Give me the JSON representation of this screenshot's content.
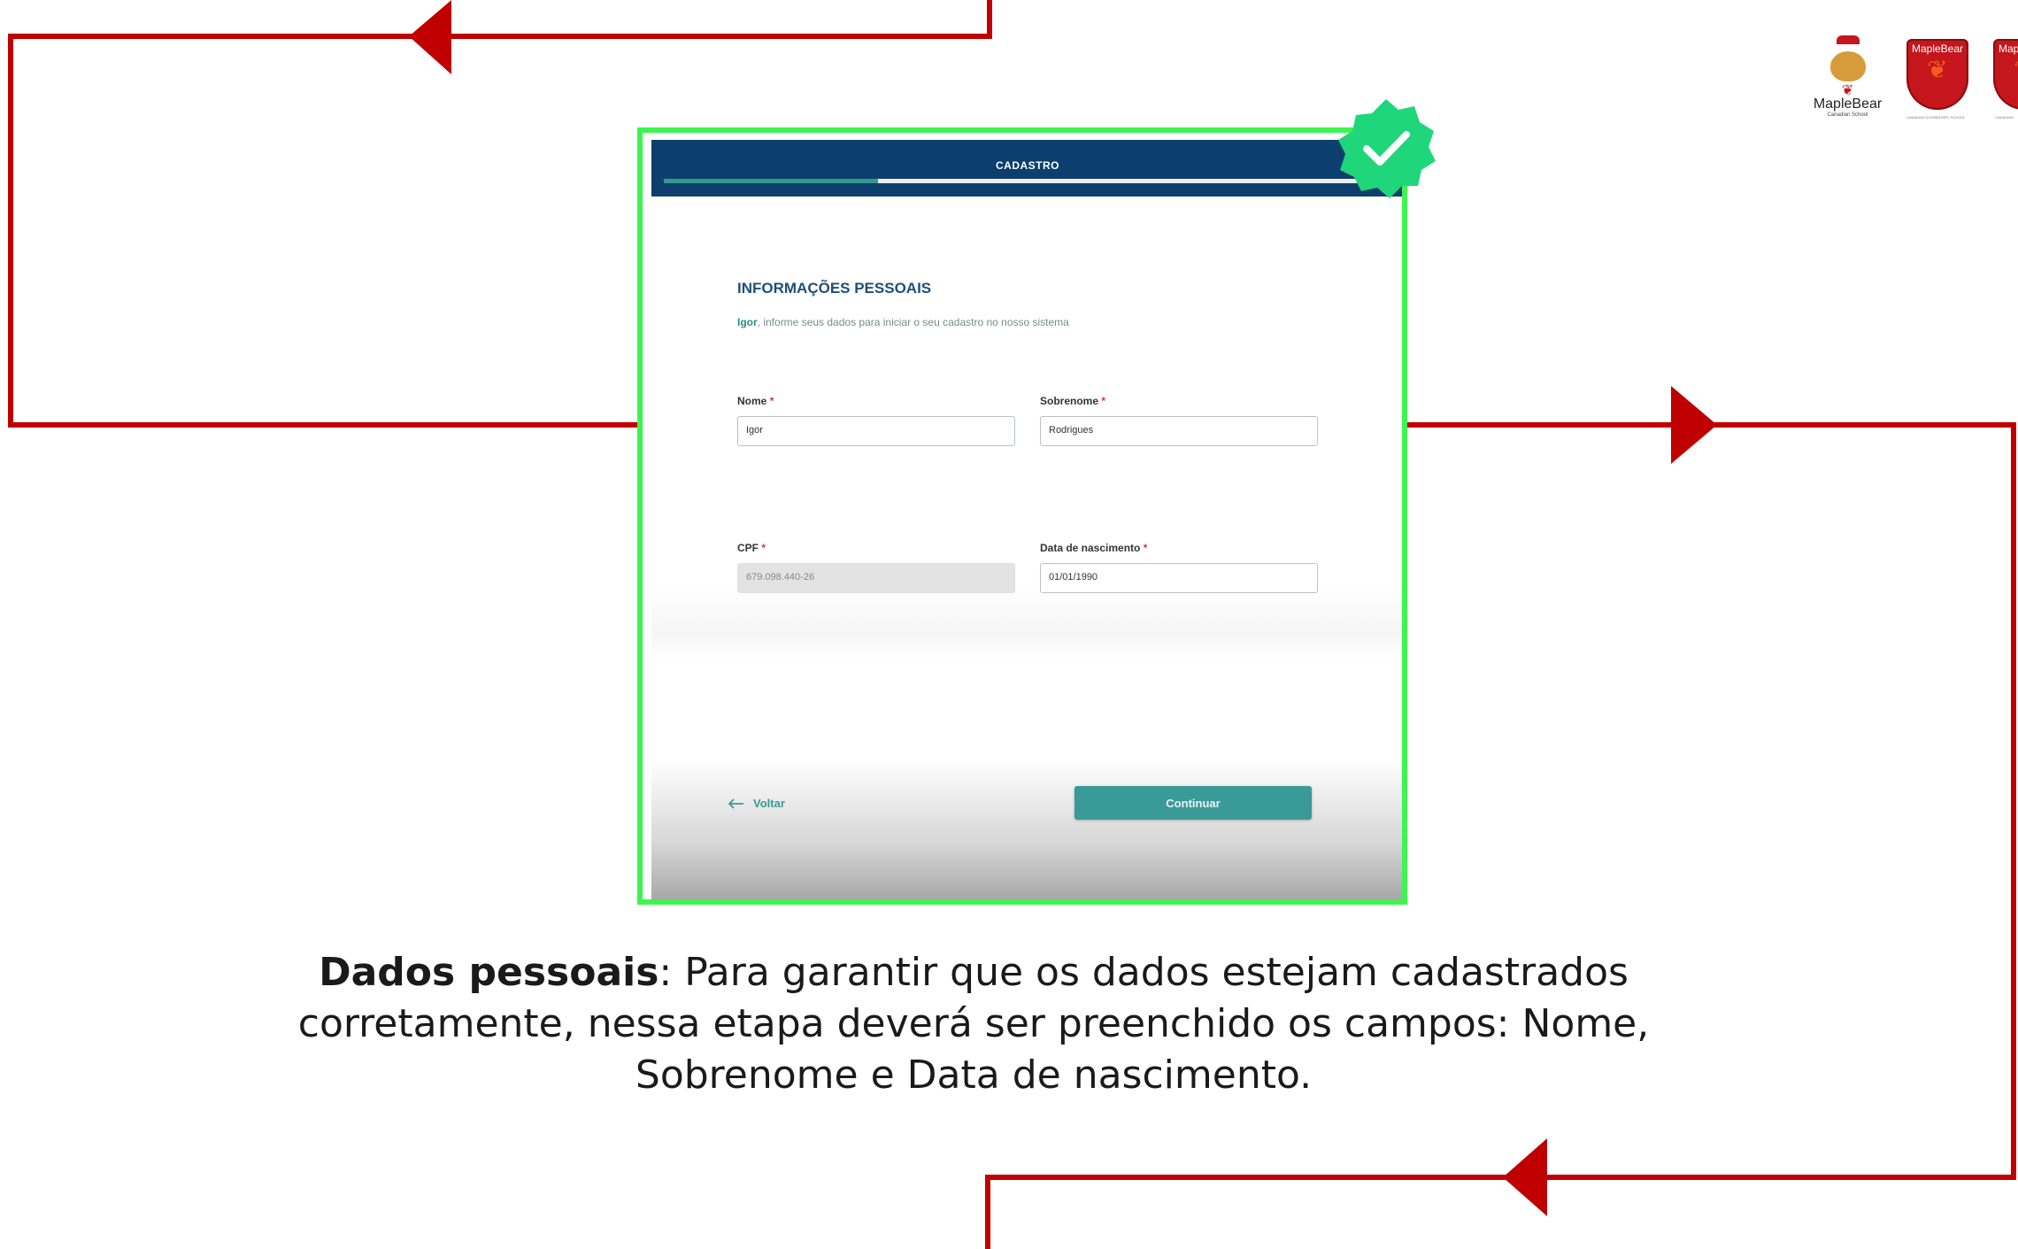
{
  "app": {
    "header_title": "CADASTRO",
    "progress_percent": 30
  },
  "section": {
    "title": "INFORMAÇÕES PESSOAIS",
    "subtitle_name": "Igor",
    "subtitle_rest": ", informe seus dados para iniciar o seu cadastro no nosso sistema"
  },
  "form": {
    "nome": {
      "label": "Nome",
      "required_mark": "*",
      "value": "Igor"
    },
    "sobrenome": {
      "label": "Sobrenome",
      "required_mark": "*",
      "value": "Rodrigues"
    },
    "cpf": {
      "label": "CPF",
      "required_mark": "*",
      "value": "679.098.440-26"
    },
    "data_nascimento": {
      "label": "Data de nascimento",
      "required_mark": "*",
      "value": "01/01/1990"
    }
  },
  "actions": {
    "back_label": "Voltar",
    "continue_label": "Continuar"
  },
  "logos": {
    "primary_brand": "MapleBear",
    "primary_sub": "Canadian School",
    "shield_1_label": "MapleBear",
    "shield_1_caption": "CANADIAN ELEMENTARY SCHOOL",
    "shield_2_label": "MapleBear",
    "shield_2_caption": "CANADIAN"
  },
  "caption": {
    "bold": "Dados pessoais",
    "text": ": Para garantir que os dados estejam cadastrados corretamente, nessa etapa deverá ser preenchido os campos: Nome, Sobrenome e Data de nascimento."
  },
  "colors": {
    "flow_line": "#c00000",
    "frame_highlight": "#3df54f",
    "header_bg": "#0c3f6e",
    "accent_teal": "#3a9a97",
    "badge_green": "#1fd67a"
  },
  "icons": {
    "check_badge": "check-badge-icon",
    "back_arrow": "arrow-left-icon"
  }
}
